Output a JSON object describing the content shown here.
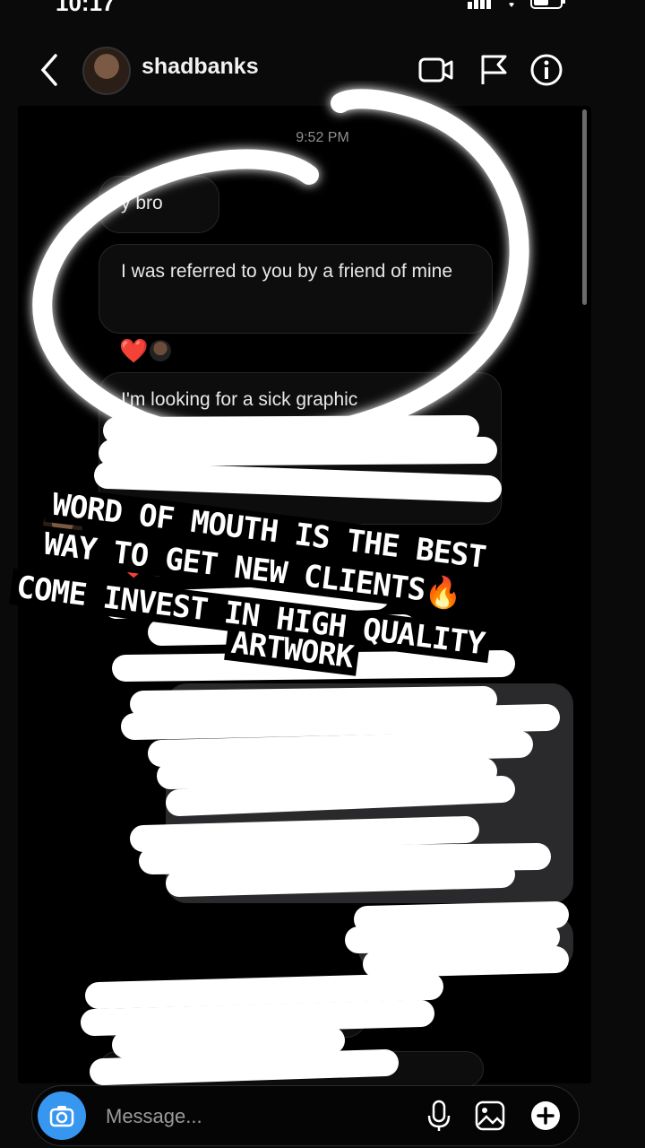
{
  "status": {
    "time": "10:17"
  },
  "header": {
    "username": "shadbanks",
    "icons": [
      "back-chevron-icon",
      "video-call-icon",
      "flag-icon",
      "info-icon"
    ]
  },
  "chat": {
    "timestamp": "9:52 PM",
    "messages": [
      {
        "text": "y bro"
      },
      {
        "text": "I was referred to you by a friend of mine"
      },
      {
        "text": "I'm looking for a sick graphic"
      }
    ],
    "partial_text_1": "Animated Story Fl",
    "reaction": "❤️"
  },
  "overlay": {
    "caption_lines": [
      "WORD OF MOUTH IS THE BEST",
      "WAY TO GET NEW CLIENTS🔥",
      "COME INVEST IN HIGH QUALITY",
      "ARTWORK"
    ]
  },
  "composer": {
    "placeholder": "Message..."
  },
  "colors": {
    "background": "#0a0a0b",
    "accent": "#3797f0",
    "heart": "#ff3040"
  }
}
